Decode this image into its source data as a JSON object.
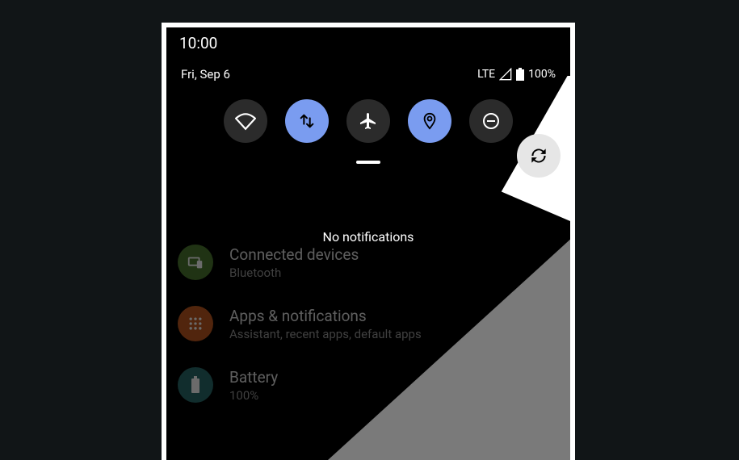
{
  "status": {
    "clock": "10:00",
    "date": "Fri, Sep 6",
    "network_type": "LTE",
    "battery_pct": "100%"
  },
  "qs_tiles": [
    {
      "name": "wifi",
      "state": "off"
    },
    {
      "name": "mobile-data",
      "state": "on"
    },
    {
      "name": "airplane",
      "state": "off"
    },
    {
      "name": "location",
      "state": "on"
    },
    {
      "name": "do-not-disturb",
      "state": "off"
    },
    {
      "name": "auto-rotate",
      "state": "light"
    }
  ],
  "notifications": {
    "empty_text": "No notifications"
  },
  "settings": [
    {
      "icon": "connected-devices",
      "icon_color": "#4c7a30",
      "title": "Connected devices",
      "sub": "Bluetooth"
    },
    {
      "icon": "apps",
      "icon_color": "#c05a1f",
      "title": "Apps & notifications",
      "sub": "Assistant, recent apps, default apps"
    },
    {
      "icon": "battery",
      "icon_color": "#2a6b6b",
      "title": "Battery",
      "sub": "100%"
    }
  ]
}
